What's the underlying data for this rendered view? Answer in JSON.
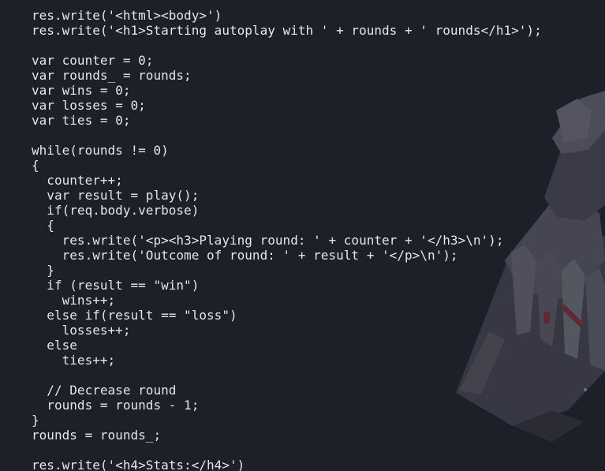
{
  "editor": {
    "language": "javascript",
    "background_color": "#1d1f29",
    "text_color": "#e6e6ea",
    "lines": [
      "res.write('<html><body>')",
      "res.write('<h1>Starting autoplay with ' + rounds + ' rounds</h1>');",
      "",
      "var counter = 0;",
      "var rounds_ = rounds;",
      "var wins = 0;",
      "var losses = 0;",
      "var ties = 0;",
      "",
      "while(rounds != 0)",
      "{",
      "  counter++;",
      "  var result = play();",
      "  if(req.body.verbose)",
      "  {",
      "    res.write('<p><h3>Playing round: ' + counter + '</h3>\\n');",
      "    res.write('Outcome of round: ' + result + '</p>\\n');",
      "  }",
      "  if (result == \"win\")",
      "    wins++;",
      "  else if(result == \"loss\")",
      "    losses++;",
      "  else",
      "    ties++;",
      "",
      "  // Decrease round",
      "  rounds = rounds - 1;",
      "}",
      "rounds = rounds_;",
      "",
      "res.write('<h4>Stats:</h4>')"
    ]
  }
}
